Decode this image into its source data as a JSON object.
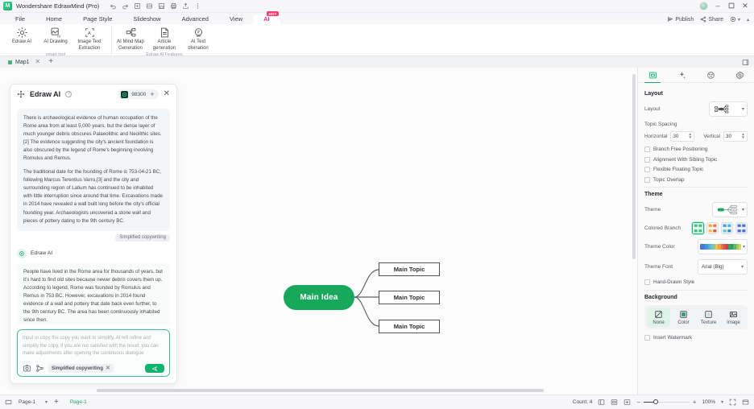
{
  "titlebar": {
    "app_title": "Wondershare EdrawMind (Pro)",
    "logo_text": "M",
    "quick_icons": [
      "undo-icon",
      "redo-icon",
      "new-icon",
      "open-icon",
      "save-icon",
      "print-icon",
      "export-icon",
      "more-icon"
    ],
    "window_controls": {
      "minimize": "–",
      "maximize": "❐",
      "close": "✕"
    }
  },
  "menubar": {
    "items": [
      {
        "label": "File",
        "active": false
      },
      {
        "label": "Home",
        "active": false
      },
      {
        "label": "Page Style",
        "active": false
      },
      {
        "label": "Slideshow",
        "active": false
      },
      {
        "label": "Advanced",
        "active": false
      },
      {
        "label": "View",
        "active": false
      },
      {
        "label": "AI",
        "active": true,
        "badge": "HOT"
      }
    ],
    "publish_label": "Publish",
    "share_label": "Share"
  },
  "ribbon": {
    "groups": [
      {
        "title": "smart tool",
        "buttons": [
          {
            "label": "Edraw AI",
            "icon": "edraw-ai-icon"
          },
          {
            "label": "AI Drawing",
            "icon": "ai-drawing-icon"
          },
          {
            "label": "Image Text Extraction",
            "icon": "image-text-extraction-icon"
          }
        ]
      },
      {
        "title": "Edraw AI Features",
        "buttons": [
          {
            "label": "AI Mind Map Generation",
            "icon": "ai-mind-map-icon"
          },
          {
            "label": "Article generation",
            "icon": "article-generation-icon"
          },
          {
            "label": "AI Text divination",
            "icon": "ai-text-divination-icon"
          }
        ]
      }
    ]
  },
  "tabstrip": {
    "tabs": [
      {
        "label": "Map1"
      }
    ],
    "new_tab": "+"
  },
  "ai_panel": {
    "title": "Edraw AI",
    "credits": "98300",
    "plus": "+",
    "close": "✕",
    "user_message": {
      "paragraphs": [
        "There is archaeological evidence of human occupation of the Rome area from at least 5,000 years, but the dense layer of much younger debris obscures Palaeolithic and Neolithic sites.[2] The evidence suggesting the city's ancient foundation is also obscured by the legend of Rome's beginning involving Romulus and Remus.",
        "The traditional date for the founding of Rome is 753-04-21 BC, following Marcus Terentius Varro,[3] and the city and surrounding region of Latium has continued to be inhabited with little interruption since around that time. Excavations made in 2014 have revealed a wall built long before the city's official founding year. Archaeologists uncovered a stone wall and pieces of pottery dating to the 9th century BC."
      ],
      "tag": "Simplified copywriting"
    },
    "reply": {
      "author": "Edraw AI",
      "text": "People have lived in the Rome area for thousands of years, but it's hard to find old sites because newer debris covers them up. According to legend, Rome was founded by Romulus and Remus in 753 BC. However, excavations in 2014 found evidence of a wall and pottery that date back even further, to the 9th century BC. The area has been continuously inhabited since then."
    },
    "input": {
      "placeholder": "Input or copy the copy you want to simplify, AI will refine and simplify the copy, if you are not satisfied with the result, you can make adjustments after opening the continuous dialogue",
      "chip": "Simplified copywriting",
      "chip_close": "✕",
      "send_icon": "send-icon",
      "tool_icons": [
        "screenshot-icon",
        "branch-icon"
      ]
    }
  },
  "mindmap": {
    "root": "Main Idea",
    "topics": [
      "Main Topic",
      "Main Topic",
      "Main Topic"
    ],
    "root_color": "#18a85c"
  },
  "right_panel": {
    "tabs": [
      {
        "name": "layout-tab",
        "icon": "layout-icon",
        "active": true
      },
      {
        "name": "style-tab",
        "icon": "sparkle-icon",
        "active": false
      },
      {
        "name": "effects-tab",
        "icon": "smiley-icon",
        "active": false
      },
      {
        "name": "settings-tab",
        "icon": "gear-icon",
        "active": false
      }
    ],
    "layout": {
      "section_title": "Layout",
      "layout_label": "Layout",
      "topic_spacing_label": "Topic Spacing",
      "horizontal_label": "Horizontal",
      "horizontal_value": "30",
      "vertical_label": "Vertical",
      "vertical_value": "30",
      "checkboxes": [
        {
          "label": "Branch Free Positioning",
          "checked": false
        },
        {
          "label": "Alignment With Sibling Topic",
          "checked": false
        },
        {
          "label": "Flexible Floating Topic",
          "checked": false
        },
        {
          "label": "Topic Overlap",
          "checked": false
        }
      ]
    },
    "theme": {
      "section_title": "Theme",
      "theme_label": "Theme",
      "colored_branch_label": "Colored Branch",
      "theme_color_label": "Theme Color",
      "theme_font_label": "Theme Font",
      "theme_font_value": "Arial (Big)",
      "hand_drawn_label": "Hand-Drawn Style",
      "hand_drawn_checked": false,
      "palette": [
        "#4a6fd4",
        "#3f7fd8",
        "#4596dc",
        "#52b0d8",
        "#6ec0c6",
        "#8dc98d",
        "#f2c14e",
        "#f0a04b",
        "#e8724b",
        "#d9534f",
        "#c7453f",
        "#2f9e6e",
        "#29a05f",
        "#5bb85a",
        "#9ecb62",
        "#d6d75a"
      ]
    },
    "background": {
      "section_title": "Background",
      "options": [
        {
          "label": "None",
          "icon": "none-icon",
          "selected": true
        },
        {
          "label": "Color",
          "icon": "color-icon",
          "selected": false
        },
        {
          "label": "Texture",
          "icon": "texture-icon",
          "selected": false
        },
        {
          "label": "Image",
          "icon": "image-icon",
          "selected": false
        }
      ],
      "watermark_label": "Insert Watermark",
      "watermark_checked": false
    }
  },
  "statusbar": {
    "page_selector": "Page-1",
    "add_page": "+",
    "active_page": "Page-1",
    "count_label": "Count: 4",
    "zoom_value": "100%",
    "zoom_minus": "−",
    "zoom_plus": "+"
  }
}
